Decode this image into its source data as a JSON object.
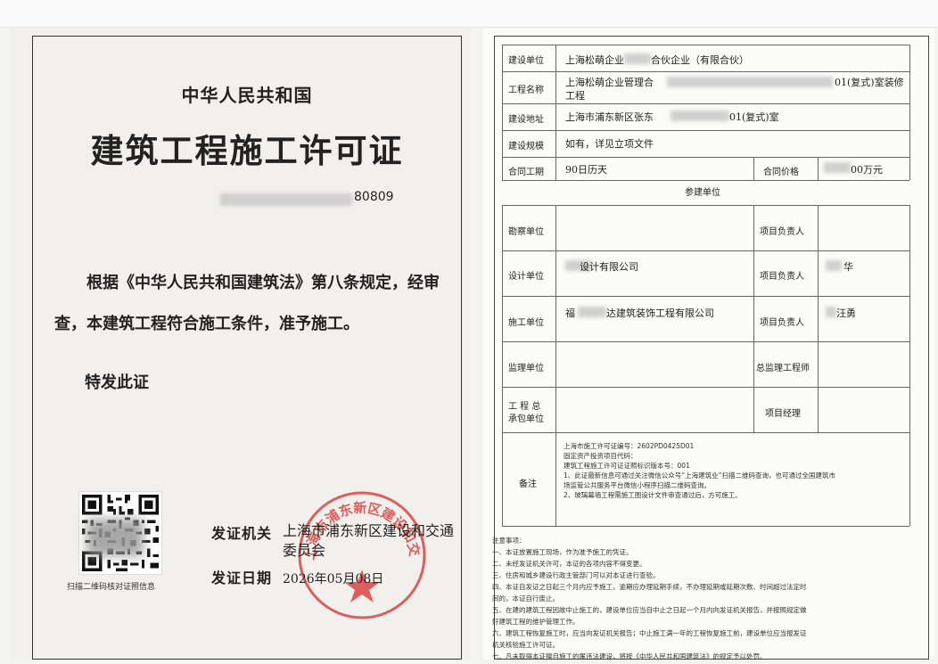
{
  "left": {
    "country": "中华人民共和国",
    "title": "建筑工程施工许可证",
    "cert_no_suffix": "80809",
    "body": "根据《中华人民共和国建筑法》第八条规定，经审查，本建筑工程符合施工条件，准予施工。",
    "special": "特发此证",
    "qr_caption": "扫描二维码核对证照信息",
    "issuer_label": "发证机关",
    "issuer_value": "上海市浦东新区建设和交通委员会",
    "date_label": "发证日期",
    "date_value": "2026年05月08日",
    "seal_text": "上海市浦东新区建设和交通委员会"
  },
  "right": {
    "rows": {
      "build_unit_label": "建设单位",
      "build_unit_value_a": "上海松萌企业",
      "build_unit_value_b": "合伙企业（有限合伙）",
      "project_name_label": "工程名称",
      "project_name_a": "上海松萌企业管理合",
      "project_name_b": "01(复式)室装修",
      "project_name_c": "工程",
      "address_label": "建设地址",
      "address_a": "上海市浦东新区张东",
      "address_b": "01(复式)室",
      "scale_label": "建设规模",
      "scale_value": "如有，详见立项文件",
      "period_label": "合同工期",
      "period_value": "90日历天",
      "price_label": "合同价格",
      "price_value": "00万元"
    },
    "participants_header": "参建单位",
    "participants": {
      "survey_label": "勘察单位",
      "survey_resp_label": "项目负责人",
      "design_label": "设计单位",
      "design_value": "设计有限公司",
      "design_resp_label": "项目负责人",
      "design_resp_value": "华",
      "construct_label": "施工单位",
      "construct_value_a": "福",
      "construct_value_b": "达建筑装饰工程有限公司",
      "construct_resp_label": "项目负责人",
      "construct_resp_value": "汪勇",
      "supervise_label": "监理单位",
      "supervise_resp_label": "总监理工程师",
      "gc_label_1": "工 程 总",
      "gc_label_2": "承包单位",
      "gc_resp_label": "项目经理"
    },
    "remarks_label": "备注",
    "remarks": [
      "上海市施工许可证编号：2602PD0425D01",
      "固定资产投资项目代码：",
      "建筑工程施工许可证证照标识版本号：001",
      "1、此证最新信息可通过关注微信公众号“上海建筑业”扫描二维码查询，也可通过全国建筑市",
      "场监管公共服务平台微信小程序扫描二维码查询。",
      "2、玻璃幕墙工程需施工图设计文件审查通过后，方可施工。"
    ],
    "notes": [
      "注意事项：",
      "一、本证放置施工现场，作为准予施工的凭证。",
      "二、未经发证机关许可，本证的各项内容不得变更。",
      "三、住房和城乡建设行政主管部门可以对本证进行查验。",
      "四、本证自发证之日起三个月内应予施工，逾期应办理延期手续，不办理延期或延期次数、时间超过法定时",
      "间的，本证自行废止。",
      "五、在建的建筑工程因故中止施工的，建设单位应当自中止之日起一个月内向发证机关报告，并按照规定做",
      "好建筑工程的维护管理工作。",
      "六、建筑工程恢复施工时，应当向发证机关报告；中止施工满一年的工程恢复施工前，建设单位应当报发证",
      "机关核验施工许可证。",
      "七、凡未取得本证擅自施工的属违法建设，将按《中华人民共和国建筑法》的规定予以处罚。"
    ]
  }
}
